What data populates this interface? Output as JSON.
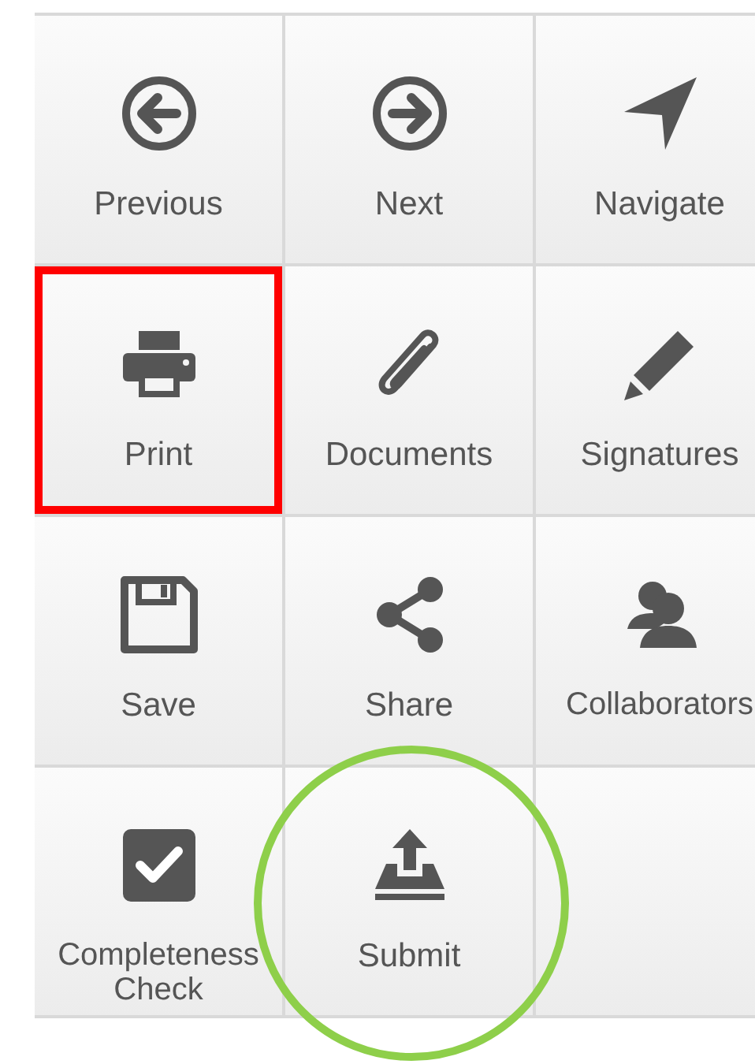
{
  "buttons": [
    {
      "kind": "arrow-left-circle",
      "label": "Previous"
    },
    {
      "kind": "arrow-right-circle",
      "label": "Next"
    },
    {
      "kind": "location-arrow",
      "label": "Navigate"
    },
    {
      "kind": "printer",
      "label": "Print",
      "highlight": {
        "kind": "rectangle",
        "color": "#ff0000"
      }
    },
    {
      "kind": "paperclip",
      "label": "Documents"
    },
    {
      "kind": "pencil",
      "label": "Signatures"
    },
    {
      "kind": "floppy",
      "label": "Save"
    },
    {
      "kind": "share",
      "label": "Share"
    },
    {
      "kind": "users",
      "label": "Collaborators"
    },
    {
      "kind": "checkbox",
      "label": "Completeness Check"
    },
    {
      "kind": "upload-tray",
      "label": "Submit",
      "highlight": {
        "kind": "circle",
        "color": "#8ecf4a"
      }
    }
  ]
}
